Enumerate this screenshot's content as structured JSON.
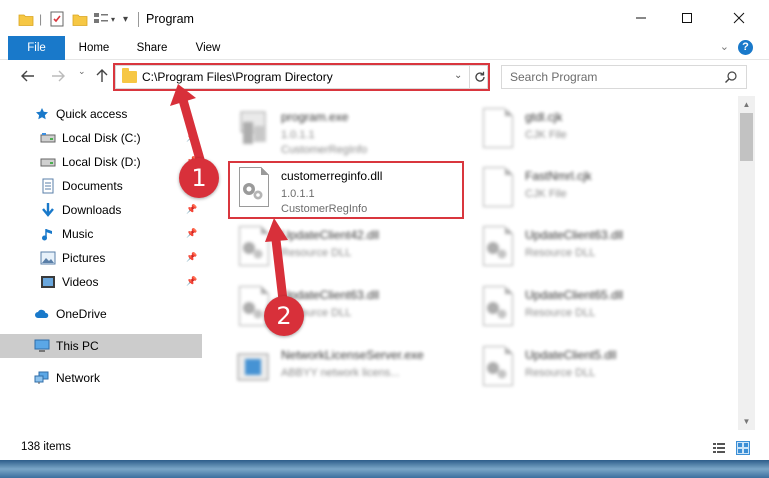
{
  "window": {
    "title": "Program",
    "controls": [
      "minimize",
      "maximize",
      "close"
    ]
  },
  "ribbon": {
    "tabs": [
      "File",
      "Home",
      "Share",
      "View"
    ],
    "help": "?"
  },
  "address_bar": {
    "path": "C:\\Program Files\\Program Directory"
  },
  "search": {
    "placeholder": "Search Program"
  },
  "sidebar": {
    "items": [
      {
        "label": "Quick access",
        "icon": "star-icon",
        "pinned": false
      },
      {
        "label": "Local Disk (C:)",
        "icon": "drive-icon",
        "pinned": true
      },
      {
        "label": "Local Disk (D:)",
        "icon": "drive-icon",
        "pinned": true
      },
      {
        "label": "Documents",
        "icon": "documents-icon",
        "pinned": true
      },
      {
        "label": "Downloads",
        "icon": "download-icon",
        "pinned": true
      },
      {
        "label": "Music",
        "icon": "music-icon",
        "pinned": true
      },
      {
        "label": "Pictures",
        "icon": "pictures-icon",
        "pinned": true
      },
      {
        "label": "Videos",
        "icon": "videos-icon",
        "pinned": true
      },
      {
        "label": "OneDrive",
        "icon": "cloud-icon",
        "pinned": false
      },
      {
        "label": "This PC",
        "icon": "computer-icon",
        "pinned": false,
        "selected": true
      },
      {
        "label": "Network",
        "icon": "network-icon",
        "pinned": false
      }
    ]
  },
  "files": [
    {
      "name": "program.exe",
      "line2": "1.0.1.1",
      "line3": "CustomerRegInfo",
      "icon": "exe-icon",
      "blurred": true
    },
    {
      "name": "gtdl.cjk",
      "line2": "CJK File",
      "line3": "",
      "icon": "file-icon",
      "blurred": true
    },
    {
      "name": "customerreginfo.dll",
      "line2": "1.0.1.1",
      "line3": "CustomerRegInfo",
      "icon": "dll-gear-icon",
      "blurred": false,
      "highlighted": true
    },
    {
      "name": "FastNmrl.cjk",
      "line2": "CJK File",
      "line3": "",
      "icon": "file-icon",
      "blurred": true
    },
    {
      "name": "UpdateClient42.dll",
      "line2": "Resource DLL",
      "line3": "",
      "icon": "dll-gear-icon",
      "blurred": true
    },
    {
      "name": "UpdateClient63.dll",
      "line2": "Resource DLL",
      "line3": "",
      "icon": "dll-gear-icon",
      "blurred": true
    },
    {
      "name": "UpdateClient63.dll",
      "line2": "Resource DLL",
      "line3": "",
      "icon": "dll-gear-icon",
      "blurred": true
    },
    {
      "name": "UpdateClient65.dll",
      "line2": "Resource DLL",
      "line3": "",
      "icon": "dll-gear-icon",
      "blurred": true
    },
    {
      "name": "NetworkLicenseServer.exe",
      "line2": "ABBYY network licens...",
      "line3": "",
      "icon": "exe-icon",
      "blurred": true
    },
    {
      "name": "UpdateClient5.dll",
      "line2": "Resource DLL",
      "line3": "",
      "icon": "dll-gear-icon",
      "blurred": true
    }
  ],
  "status": {
    "item_count": "138 items"
  },
  "annotations": {
    "step1": "1",
    "step2": "2",
    "highlight_color": "#d9363e"
  }
}
